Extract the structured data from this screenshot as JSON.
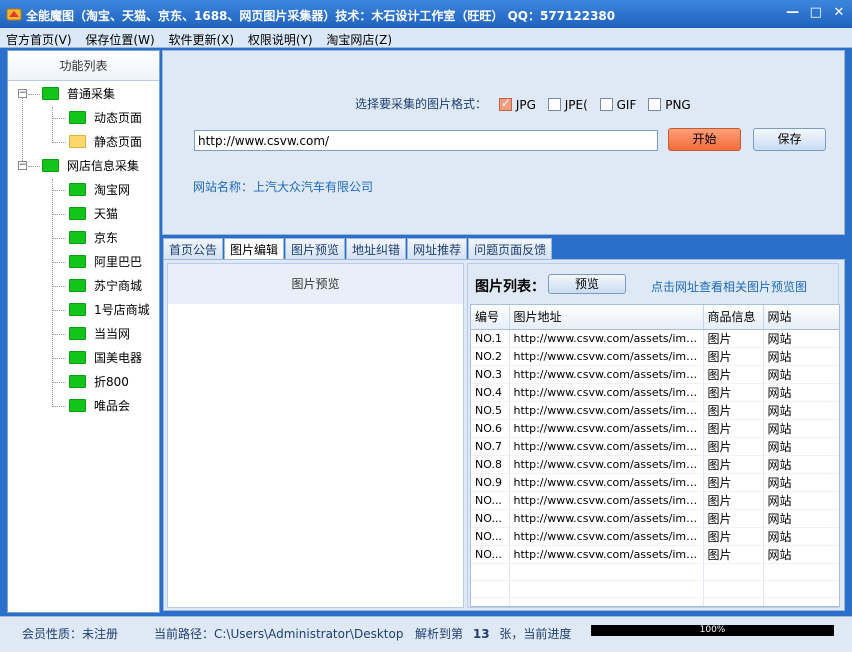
{
  "window": {
    "title": "全能魔图（淘宝、天猫、京东、1688、网页图片采集器）技术：木石设计工作室（旺旺）   QQ：577122380",
    "minimize": "—",
    "maximize": "□",
    "close": "✕"
  },
  "menu": [
    "官方首页(V)",
    "保存位置(W)",
    "软件更新(X)",
    "权限说明(Y)",
    "淘宝网店(Z)"
  ],
  "sidebar": {
    "title": "功能列表",
    "groups": [
      {
        "label": "普通采集",
        "expander": "−",
        "items": [
          {
            "label": "动态页面",
            "color": "green"
          },
          {
            "label": "静态页面",
            "color": "yellow"
          }
        ]
      },
      {
        "label": "网店信息采集",
        "expander": "−",
        "items": [
          {
            "label": "淘宝网"
          },
          {
            "label": "天猫"
          },
          {
            "label": "京东"
          },
          {
            "label": "阿里巴巴"
          },
          {
            "label": "苏宁商城"
          },
          {
            "label": "1号店商城"
          },
          {
            "label": "当当网"
          },
          {
            "label": "国美电器"
          },
          {
            "label": "折800"
          },
          {
            "label": "唯品会"
          }
        ]
      }
    ]
  },
  "format": {
    "label": "选择要采集的图片格式：",
    "options": [
      {
        "label": "JPG",
        "checked": true
      },
      {
        "label": "JPE(",
        "checked": false
      },
      {
        "label": "GIF",
        "checked": false
      },
      {
        "label": "PNG",
        "checked": false
      }
    ]
  },
  "url_input": {
    "value": "http://www.csvw.com/"
  },
  "buttons": {
    "start": "开始",
    "save": "保存",
    "preview": "预览"
  },
  "site": {
    "label": "网站名称：",
    "name": "上汽大众汽车有限公司"
  },
  "tabs": [
    {
      "label": "首页公告",
      "active": false
    },
    {
      "label": "图片编辑",
      "active": true
    },
    {
      "label": "图片预览",
      "active": false
    },
    {
      "label": "地址纠错",
      "active": false
    },
    {
      "label": "网址推荐",
      "active": false
    },
    {
      "label": "问题页面反馈",
      "active": false
    }
  ],
  "preview": {
    "title": "图片预览"
  },
  "list": {
    "header": "图片列表：",
    "hint": "点击网址查看相关图片预览图",
    "columns": [
      "编号",
      "图片地址",
      "商品信息",
      "网站"
    ],
    "rows": [
      [
        "NO.1",
        "http://www.csvw.com/assets/imag...",
        "图片",
        "网站"
      ],
      [
        "NO.2",
        "http://www.csvw.com/assets/imag...",
        "图片",
        "网站"
      ],
      [
        "NO.3",
        "http://www.csvw.com/assets/imag...",
        "图片",
        "网站"
      ],
      [
        "NO.4",
        "http://www.csvw.com/assets/imag...",
        "图片",
        "网站"
      ],
      [
        "NO.5",
        "http://www.csvw.com/assets/imag...",
        "图片",
        "网站"
      ],
      [
        "NO.6",
        "http://www.csvw.com/assets/imag...",
        "图片",
        "网站"
      ],
      [
        "NO.7",
        "http://www.csvw.com/assets/imag...",
        "图片",
        "网站"
      ],
      [
        "NO.8",
        "http://www.csvw.com/assets/imag...",
        "图片",
        "网站"
      ],
      [
        "NO.9",
        "http://www.csvw.com/assets/imag...",
        "图片",
        "网站"
      ],
      [
        "NO...",
        "http://www.csvw.com/assets/imag...",
        "图片",
        "网站"
      ],
      [
        "NO...",
        "http://www.csvw.com/assets/imag...",
        "图片",
        "网站"
      ],
      [
        "NO...",
        "http://www.csvw.com/assets/imag...",
        "图片",
        "网站"
      ],
      [
        "NO...",
        "http://www.csvw.com/assets/imag...",
        "图片",
        "网站"
      ]
    ]
  },
  "status": {
    "member": "会员性质：未注册",
    "path": "当前路径：C:\\Users\\Administrator\\Desktop",
    "parsed_prefix": "解析到第",
    "parsed_count": "13",
    "parsed_suffix": "张，当前进度",
    "progress_text": "100%",
    "progress_value": 1.0
  }
}
